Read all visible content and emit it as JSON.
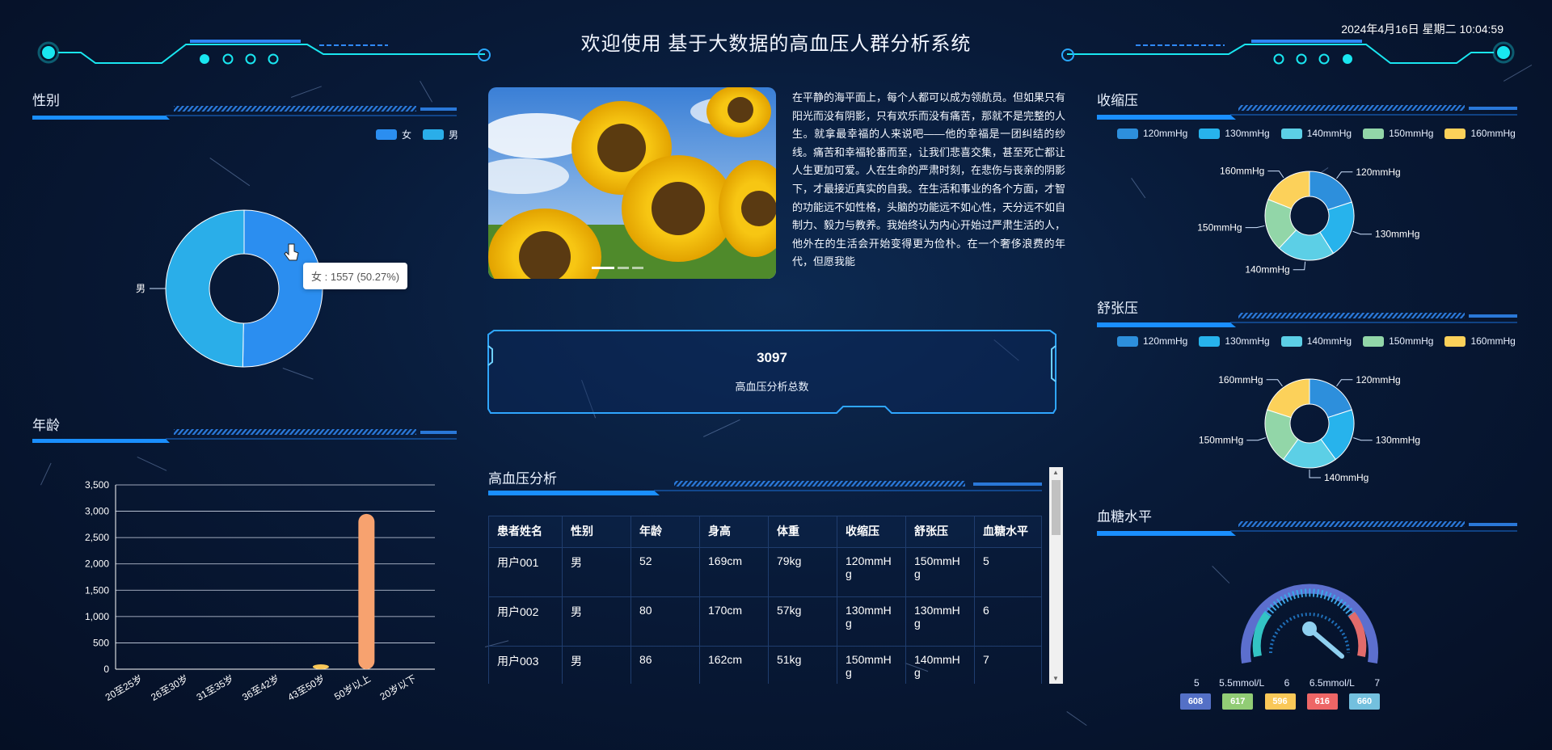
{
  "header": {
    "title": "欢迎使用 基于大数据的高血压人群分析系统",
    "datetime": "2024年4月16日 星期二 10:04:59"
  },
  "gender": {
    "title": "性别",
    "legend": [
      {
        "label": "女",
        "color": "#2b8ef0"
      },
      {
        "label": "男",
        "color": "#2aaee9"
      }
    ],
    "outer_label": "男",
    "tooltip": "女 : 1557 (50.27%)"
  },
  "age": {
    "title": "年龄"
  },
  "article": {
    "text": "在平静的海平面上，每个人都可以成为领航员。但如果只有阳光而没有阴影，只有欢乐而没有痛苦，那就不是完整的人生。就拿最幸福的人来说吧——他的幸福是一团纠结的纱线。痛苦和幸福轮番而至，让我们悲喜交集，甚至死亡都让人生更加可爱。人在生命的严肃时刻，在悲伤与丧亲的阴影下，才最接近真实的自我。在生活和事业的各个方面，才智的功能远不如性格，头脑的功能远不如心性，天分远不如自制力、毅力与教养。我始终认为内心开始过严肃生活的人，他外在的生活会开始变得更为俭朴。在一个奢侈浪费的年代，但愿我能"
  },
  "total": {
    "value": "3097",
    "label": "高血压分析总数"
  },
  "table": {
    "title": "高血压分析",
    "headers": [
      "患者姓名",
      "性别",
      "年龄",
      "身高",
      "体重",
      "收缩压",
      "舒张压",
      "血糖水平"
    ],
    "rows": [
      [
        "用户001",
        "男",
        "52",
        "169cm",
        "79kg",
        "120mmHg",
        "150mmHg",
        "5"
      ],
      [
        "用户002",
        "男",
        "80",
        "170cm",
        "57kg",
        "130mmHg",
        "130mmHg",
        "6"
      ],
      [
        "用户003",
        "男",
        "86",
        "162cm",
        "51kg",
        "150mmHg",
        "140mmHg",
        "7"
      ]
    ]
  },
  "systolic": {
    "title": "收缩压",
    "legend": [
      "120mmHg",
      "130mmHg",
      "140mmHg",
      "150mmHg",
      "160mmHg"
    ],
    "labels": {
      "l120": "120mmHg",
      "l130": "130mmHg",
      "l140": "140mmHg",
      "l150": "150mmHg",
      "l160": "160mmHg"
    }
  },
  "diastolic": {
    "title": "舒张压",
    "legend": [
      "120mmHg",
      "130mmHg",
      "140mmHg",
      "150mmHg",
      "160mmHg"
    ],
    "labels": {
      "l120": "120mmHg",
      "l130": "130mmHg",
      "l140": "140mmHg",
      "l150": "150mmHg",
      "l160": "160mmHg"
    }
  },
  "glucose": {
    "title": "血糖水平",
    "scale_labels": [
      "5",
      "5.5mmol/L",
      "6",
      "6.5mmol/L",
      "7"
    ],
    "badges": [
      {
        "value": "608",
        "color": "#5470c6"
      },
      {
        "value": "617",
        "color": "#91cc75"
      },
      {
        "value": "596",
        "color": "#fac858"
      },
      {
        "value": "616",
        "color": "#ee6666"
      },
      {
        "value": "660",
        "color": "#73c0de"
      }
    ]
  },
  "colors": {
    "accent": "#1e90ff",
    "cyan": "#19e6f0",
    "pie5": [
      "#2d8fdc",
      "#27b3ec",
      "#5ccfe6",
      "#92d6a8",
      "#fcd15a"
    ]
  },
  "chart_data": [
    {
      "type": "pie",
      "title": "性别",
      "categories": [
        "女",
        "男"
      ],
      "values": [
        1557,
        1540
      ],
      "colors": [
        "#2b8ef0",
        "#2aaee9"
      ]
    },
    {
      "type": "bar",
      "title": "年龄",
      "categories": [
        "20至25岁",
        "26至30岁",
        "31至35岁",
        "36至42岁",
        "43至50岁",
        "50岁以上",
        "20岁以下"
      ],
      "values": [
        0,
        0,
        0,
        0,
        60,
        2950,
        0
      ],
      "bar_colors": [
        "#5470c6",
        "#91cc75",
        "#fac858",
        "#ee6666",
        "#fac858",
        "#f7a26f",
        "#73c0de"
      ],
      "ylim": [
        0,
        3500
      ],
      "yticks": [
        "0",
        "500",
        "1,000",
        "1,500",
        "2,000",
        "2,500",
        "3,000",
        "3,500"
      ],
      "grid": true
    },
    {
      "type": "pie",
      "title": "收缩压",
      "categories": [
        "120mmHg",
        "130mmHg",
        "140mmHg",
        "150mmHg",
        "160mmHg"
      ],
      "values": [
        20,
        21,
        21,
        19,
        19
      ]
    },
    {
      "type": "pie",
      "title": "舒张压",
      "categories": [
        "120mmHg",
        "130mmHg",
        "140mmHg",
        "150mmHg",
        "160mmHg"
      ],
      "values": [
        20,
        20,
        20,
        20,
        20
      ]
    }
  ]
}
